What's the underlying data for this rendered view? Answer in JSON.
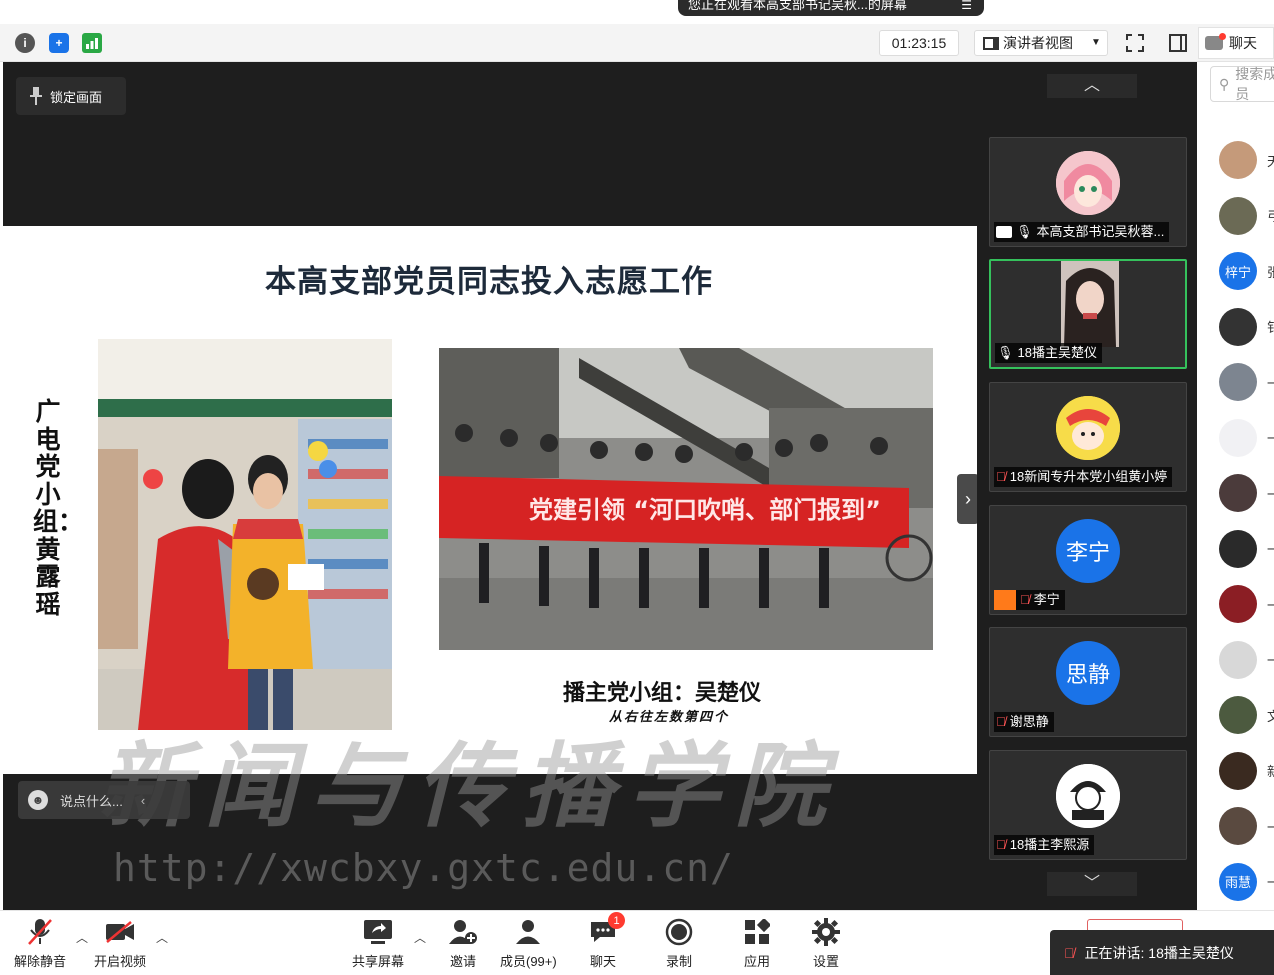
{
  "banner": {
    "text": "您正在观看本高支部书记吴秋...的屏幕",
    "menu_icon": "list-icon"
  },
  "toolbar": {
    "timer": "01:23:15",
    "view_label": "演讲者视图",
    "chat_label": "聊天"
  },
  "share": {
    "lock_label": "锁定画面",
    "comment_placeholder": "说点什么...",
    "slide": {
      "title": "本高支部党员同志投入志愿工作",
      "vertical_label": "广电党小组：黄露瑶",
      "photo_banner_text": "党建引领 “河口吹哨、部门报到”",
      "caption_main": "播主党小组：吴楚仪",
      "caption_sub": "从右往左数第四个"
    },
    "watermark": {
      "main": "新闻与传播学院",
      "url": "http://xwcbxy.gxtc.edu.cn/"
    }
  },
  "gallery": {
    "tiles": [
      {
        "name": "本高支部书记吴秋蓉...",
        "type": "avatar-anime"
      },
      {
        "name": "18播主吴楚仪",
        "type": "video",
        "active": true
      },
      {
        "name": "18新闻专升本党小组黄小婷",
        "type": "avatar-cartoon"
      },
      {
        "name": "李宁",
        "type": "initials",
        "initials": "李宁"
      },
      {
        "name": "谢思静",
        "type": "initials",
        "initials": "思静"
      },
      {
        "name": "18播主李熙源",
        "type": "avatar-sketch"
      }
    ]
  },
  "members": {
    "search_placeholder": "搜索成员",
    "rows": [
      {
        "initial": "天",
        "avatar_color": "#c59a7a"
      },
      {
        "initial": "弓",
        "avatar_color": "#6b6a55"
      },
      {
        "initial": "张",
        "avatar_color": "#1a73e8",
        "label": "梓宁"
      },
      {
        "initial": "钅",
        "avatar_color": "#333333"
      },
      {
        "initial": "一",
        "avatar_color": "#7d8590"
      },
      {
        "initial": "一",
        "avatar_color": "#f1f1f4"
      },
      {
        "initial": "一",
        "avatar_color": "#4b3b3b"
      },
      {
        "initial": "一",
        "avatar_color": "#2a2a2a"
      },
      {
        "initial": "一",
        "avatar_color": "#8b1e24"
      },
      {
        "initial": "一",
        "avatar_color": "#d8d8d8"
      },
      {
        "initial": "文",
        "avatar_color": "#4c5a3f"
      },
      {
        "initial": "新",
        "avatar_color": "#3a2a20"
      },
      {
        "initial": "一",
        "avatar_color": "#5a4a40"
      },
      {
        "initial": "一",
        "avatar_color": "#1a73e8",
        "label": "雨慧"
      }
    ]
  },
  "bottombar": {
    "mute": "解除静音",
    "video": "开启视频",
    "share": "共享屏幕",
    "invite": "邀请",
    "members": "成员(99+)",
    "chat": "聊天",
    "chat_badge": "1",
    "record": "录制",
    "apps": "应用",
    "settings": "设置",
    "speaking": "正在讲话: 18播主吴楚仪"
  },
  "colors": {
    "accent": "#1a73e8",
    "active_border": "#35c15c",
    "dark_bg": "#1e1e1e"
  }
}
